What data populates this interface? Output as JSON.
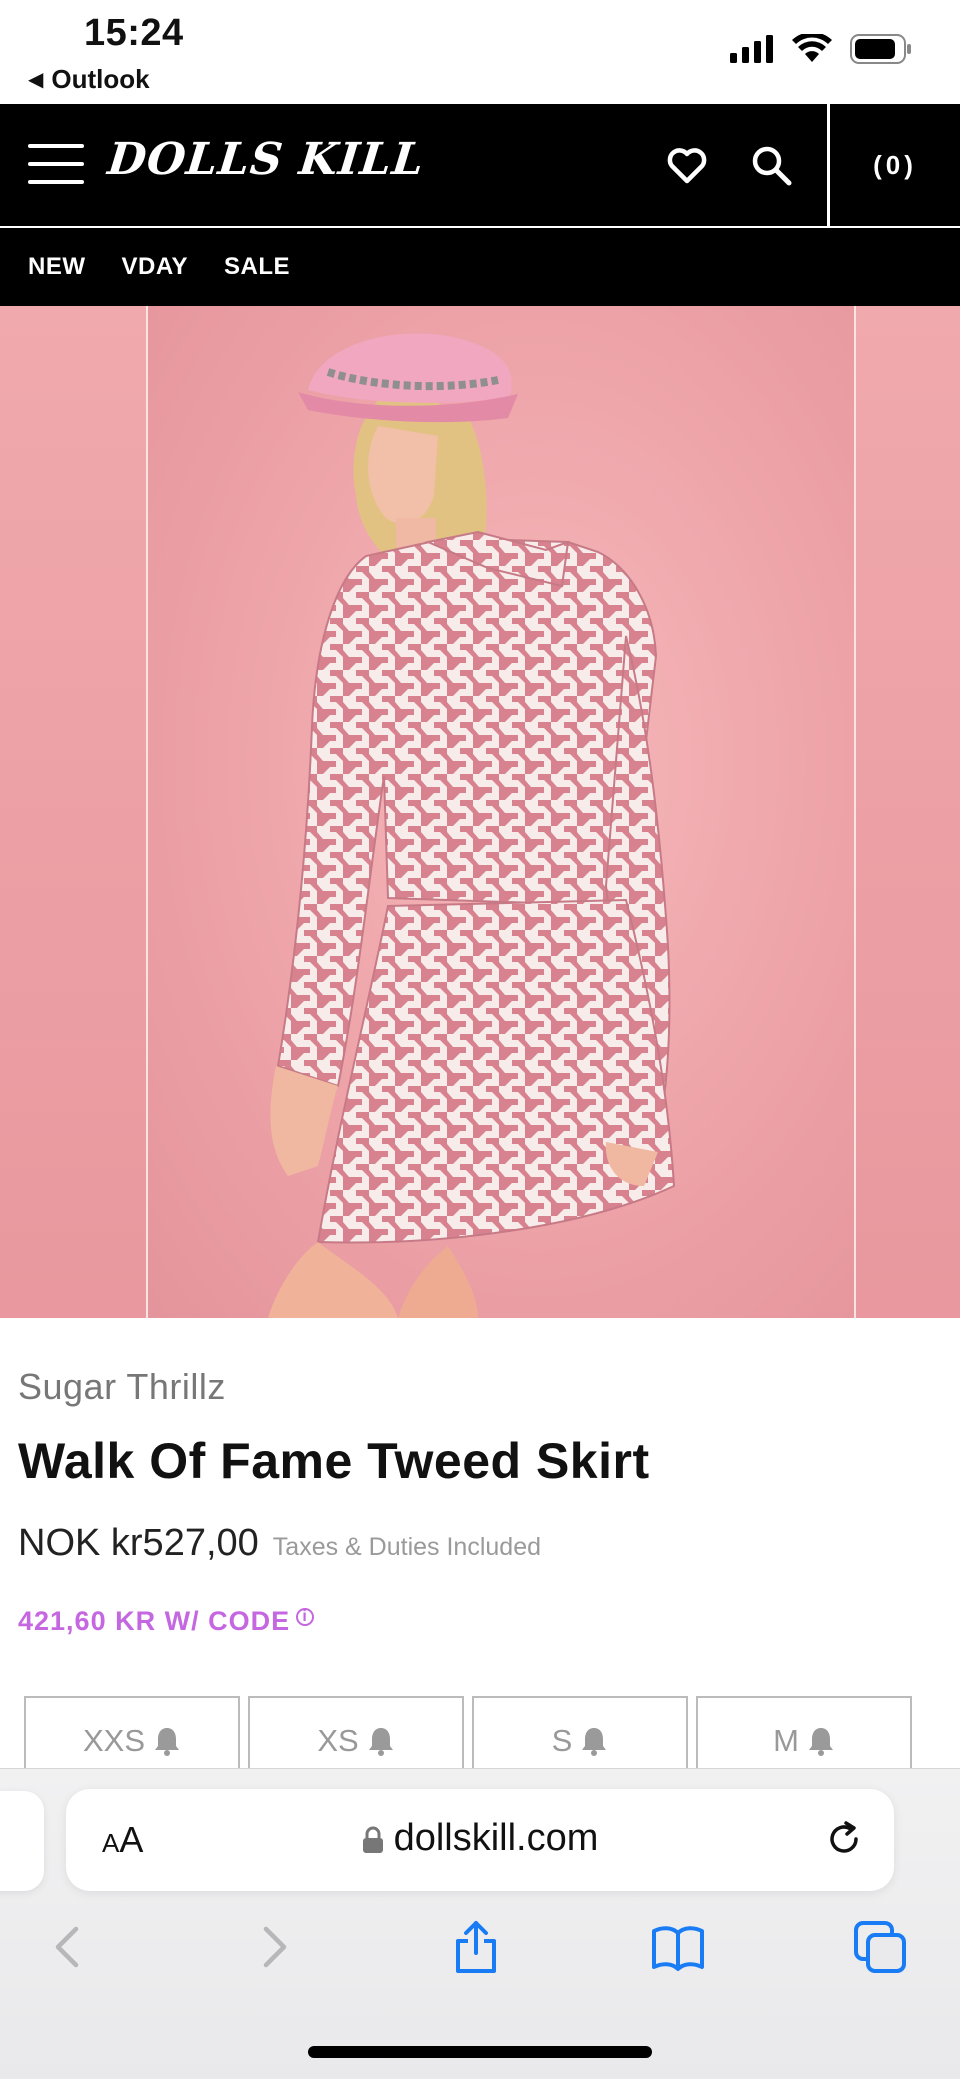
{
  "status_bar": {
    "time": "15:24",
    "back_app": "Outlook",
    "icons": [
      "signal-icon",
      "wifi-icon",
      "battery-icon"
    ]
  },
  "header": {
    "logo_text": "DOLLS KILL",
    "icons": [
      "menu-icon",
      "heart-icon",
      "search-icon"
    ],
    "cart_count": "(0)"
  },
  "nav": {
    "items": [
      "NEW",
      "VDAY",
      "SALE"
    ]
  },
  "product": {
    "brand": "Sugar Thrillz",
    "title": "Walk Of Fame Tweed Skirt",
    "price": "NOK kr527,00",
    "tax_note": "Taxes & Duties Included",
    "promo": "421,60 KR W/ CODE",
    "promo_info_icon": "info-icon",
    "sizes": [
      "XXS",
      "XS",
      "S",
      "M"
    ],
    "size_icon": "bell-icon"
  },
  "browser": {
    "text_size_label_small": "A",
    "text_size_label_large": "A",
    "url": "dollskill.com",
    "toolbar_icons": [
      "back-icon",
      "forward-icon",
      "share-icon",
      "bookmarks-icon",
      "tabs-icon"
    ]
  },
  "colors": {
    "header_bg": "#000000",
    "promo": "#c567e0",
    "photo_background": "#ec9fa5",
    "safari_blue": "#1a7cf5"
  }
}
